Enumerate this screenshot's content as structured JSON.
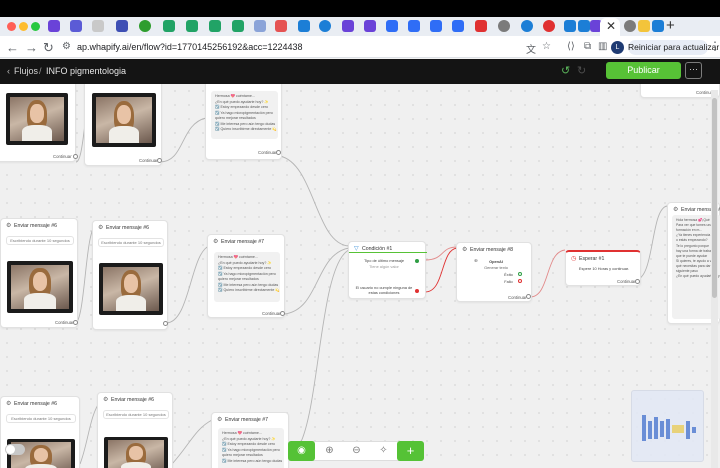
{
  "browser": {
    "url": "ap.whapify.ai/en/flow?id=1770145256192&acc=1224438",
    "update_label": "Reiniciar para actualizar",
    "profile_initial": "L",
    "tab_close": "✕",
    "tab_plus": "+"
  },
  "header": {
    "breadcrumb_back": "‹",
    "breadcrumb_link": "Flujos",
    "breadcrumb_sep": "/",
    "breadcrumb_current": "INFO pigmentologia",
    "publish_label": "Publicar",
    "more_label": "···"
  },
  "nodes": {
    "send_label": "Enviar mensaje #6",
    "send6b_label": "Enviar mensaje #6",
    "send7_label": "Enviar mensaje #7",
    "send8_label": "Enviar mensaje #8",
    "send7b_label": "Enviar mensaje #7",
    "cond_label": "Condición #1",
    "wait_label": "Esperar #1",
    "continue": "Continuar",
    "pill_writing": "Escribiendo durante 10 segundos",
    "chat_lines": [
      "Hermosa 💖 cuéntame...",
      "¿En qué puedo ayudarte hoy? ✨",
      "☑️ Estoy empezando desde cero",
      "☑️ Ya hago micropigmentación pero",
      "quiero mejorar resultados",
      "☑️ Me interesa pero aún tengo dudas",
      "☑️ Quiero inscribirme directamente 💫"
    ],
    "cond_rule": "Tipo de último mensaje",
    "cond_any": "Tiene algún valor",
    "cond_else": "El usuario no cumple ninguna de estas condiciones",
    "openai_title": "OpenAI",
    "openai_sub": "Generar texto",
    "success": "Éxito",
    "failure": "Fallo",
    "wait_text": "Espere 10 Horas y continuar.",
    "right_lines": [
      "Hola hermosa 💕¡Qué",
      "",
      "Para ver que tomes una",
      "formación en m...",
      "",
      "¿Ya tienes experiencia",
      "o estás empezando?",
      "",
      "Te lo pregunto porque",
      "hay una forma de trabajar",
      "que te puede ayudar",
      "",
      "Si quieres, te ayudo a ver",
      "qué necesitas para dar el",
      "siguiente paso",
      "",
      "¿En qué puedo ayudarte hoy?"
    ]
  },
  "toolbar": {
    "eye_icon": "◉",
    "zoom_in_icon": "⊕",
    "zoom_out_icon": "⊖",
    "magic_icon": "✧",
    "add_icon": "+"
  }
}
